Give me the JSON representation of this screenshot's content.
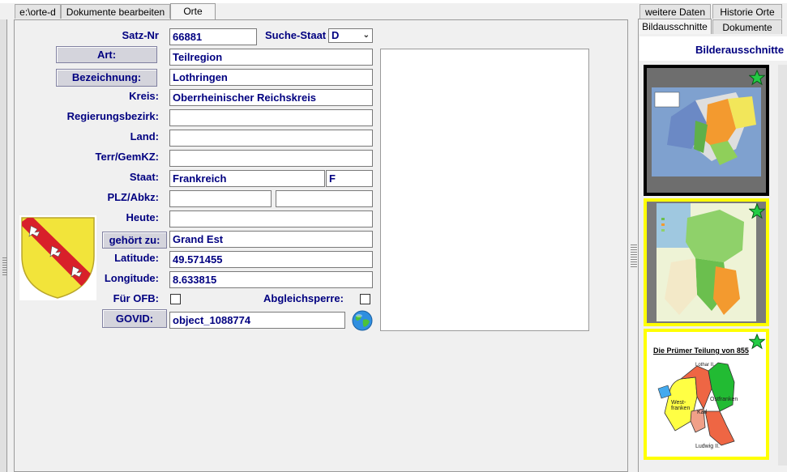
{
  "tabs_left": [
    "e:\\orte-d",
    "Dokumente bearbeiten",
    "Orte"
  ],
  "tabs_right_top": [
    "weitere Daten",
    "Historie Orte"
  ],
  "tabs_right_bottom": [
    "Bildausschnitte",
    "Dokumente"
  ],
  "form": {
    "satz_nr_label": "Satz-Nr",
    "satz_nr": "66881",
    "suche_staat_label": "Suche-Staat",
    "suche_staat": "D",
    "art_button": "Art:",
    "art": "Teilregion",
    "bezeichnung_button": "Bezeichnung:",
    "bezeichnung": "Lothringen",
    "kreis_label": "Kreis:",
    "kreis": "Oberrheinischer Reichskreis",
    "regierungsbezirk_label": "Regierungsbezirk:",
    "regierungsbezirk": "",
    "land_label": "Land:",
    "land": "",
    "terr_label": "Terr/GemKZ:",
    "terr": "",
    "staat_label": "Staat:",
    "staat": "Frankreich",
    "staat_code": "F",
    "plz_label": "PLZ/Abkz:",
    "plz": "",
    "abkz": "",
    "heute_label": "Heute:",
    "heute": "",
    "gehoert_button": "gehört zu:",
    "gehoert": "Grand Est",
    "latitude_label": "Latitude:",
    "latitude": "49.571455",
    "longitude_label": "Longitude:",
    "longitude": "8.633815",
    "fuer_ofb_label": "Für OFB:",
    "abgleichsperre_label": "Abgleichsperre:",
    "govid_button": "GOVID:",
    "govid": "object_1088774"
  },
  "right_panel": {
    "title": "Bilderausschnitte",
    "map3_title": "Die Prümer Teilung von 855",
    "map3_labels": [
      "Lothar II.",
      "West-franken",
      "Karl",
      "Ostfranken",
      "Ludwig II."
    ]
  },
  "colors": {
    "label_blue": "#000080",
    "thumb_selected_border": "#000000",
    "thumb_border": "#ffff00",
    "star": "#22cc44"
  }
}
